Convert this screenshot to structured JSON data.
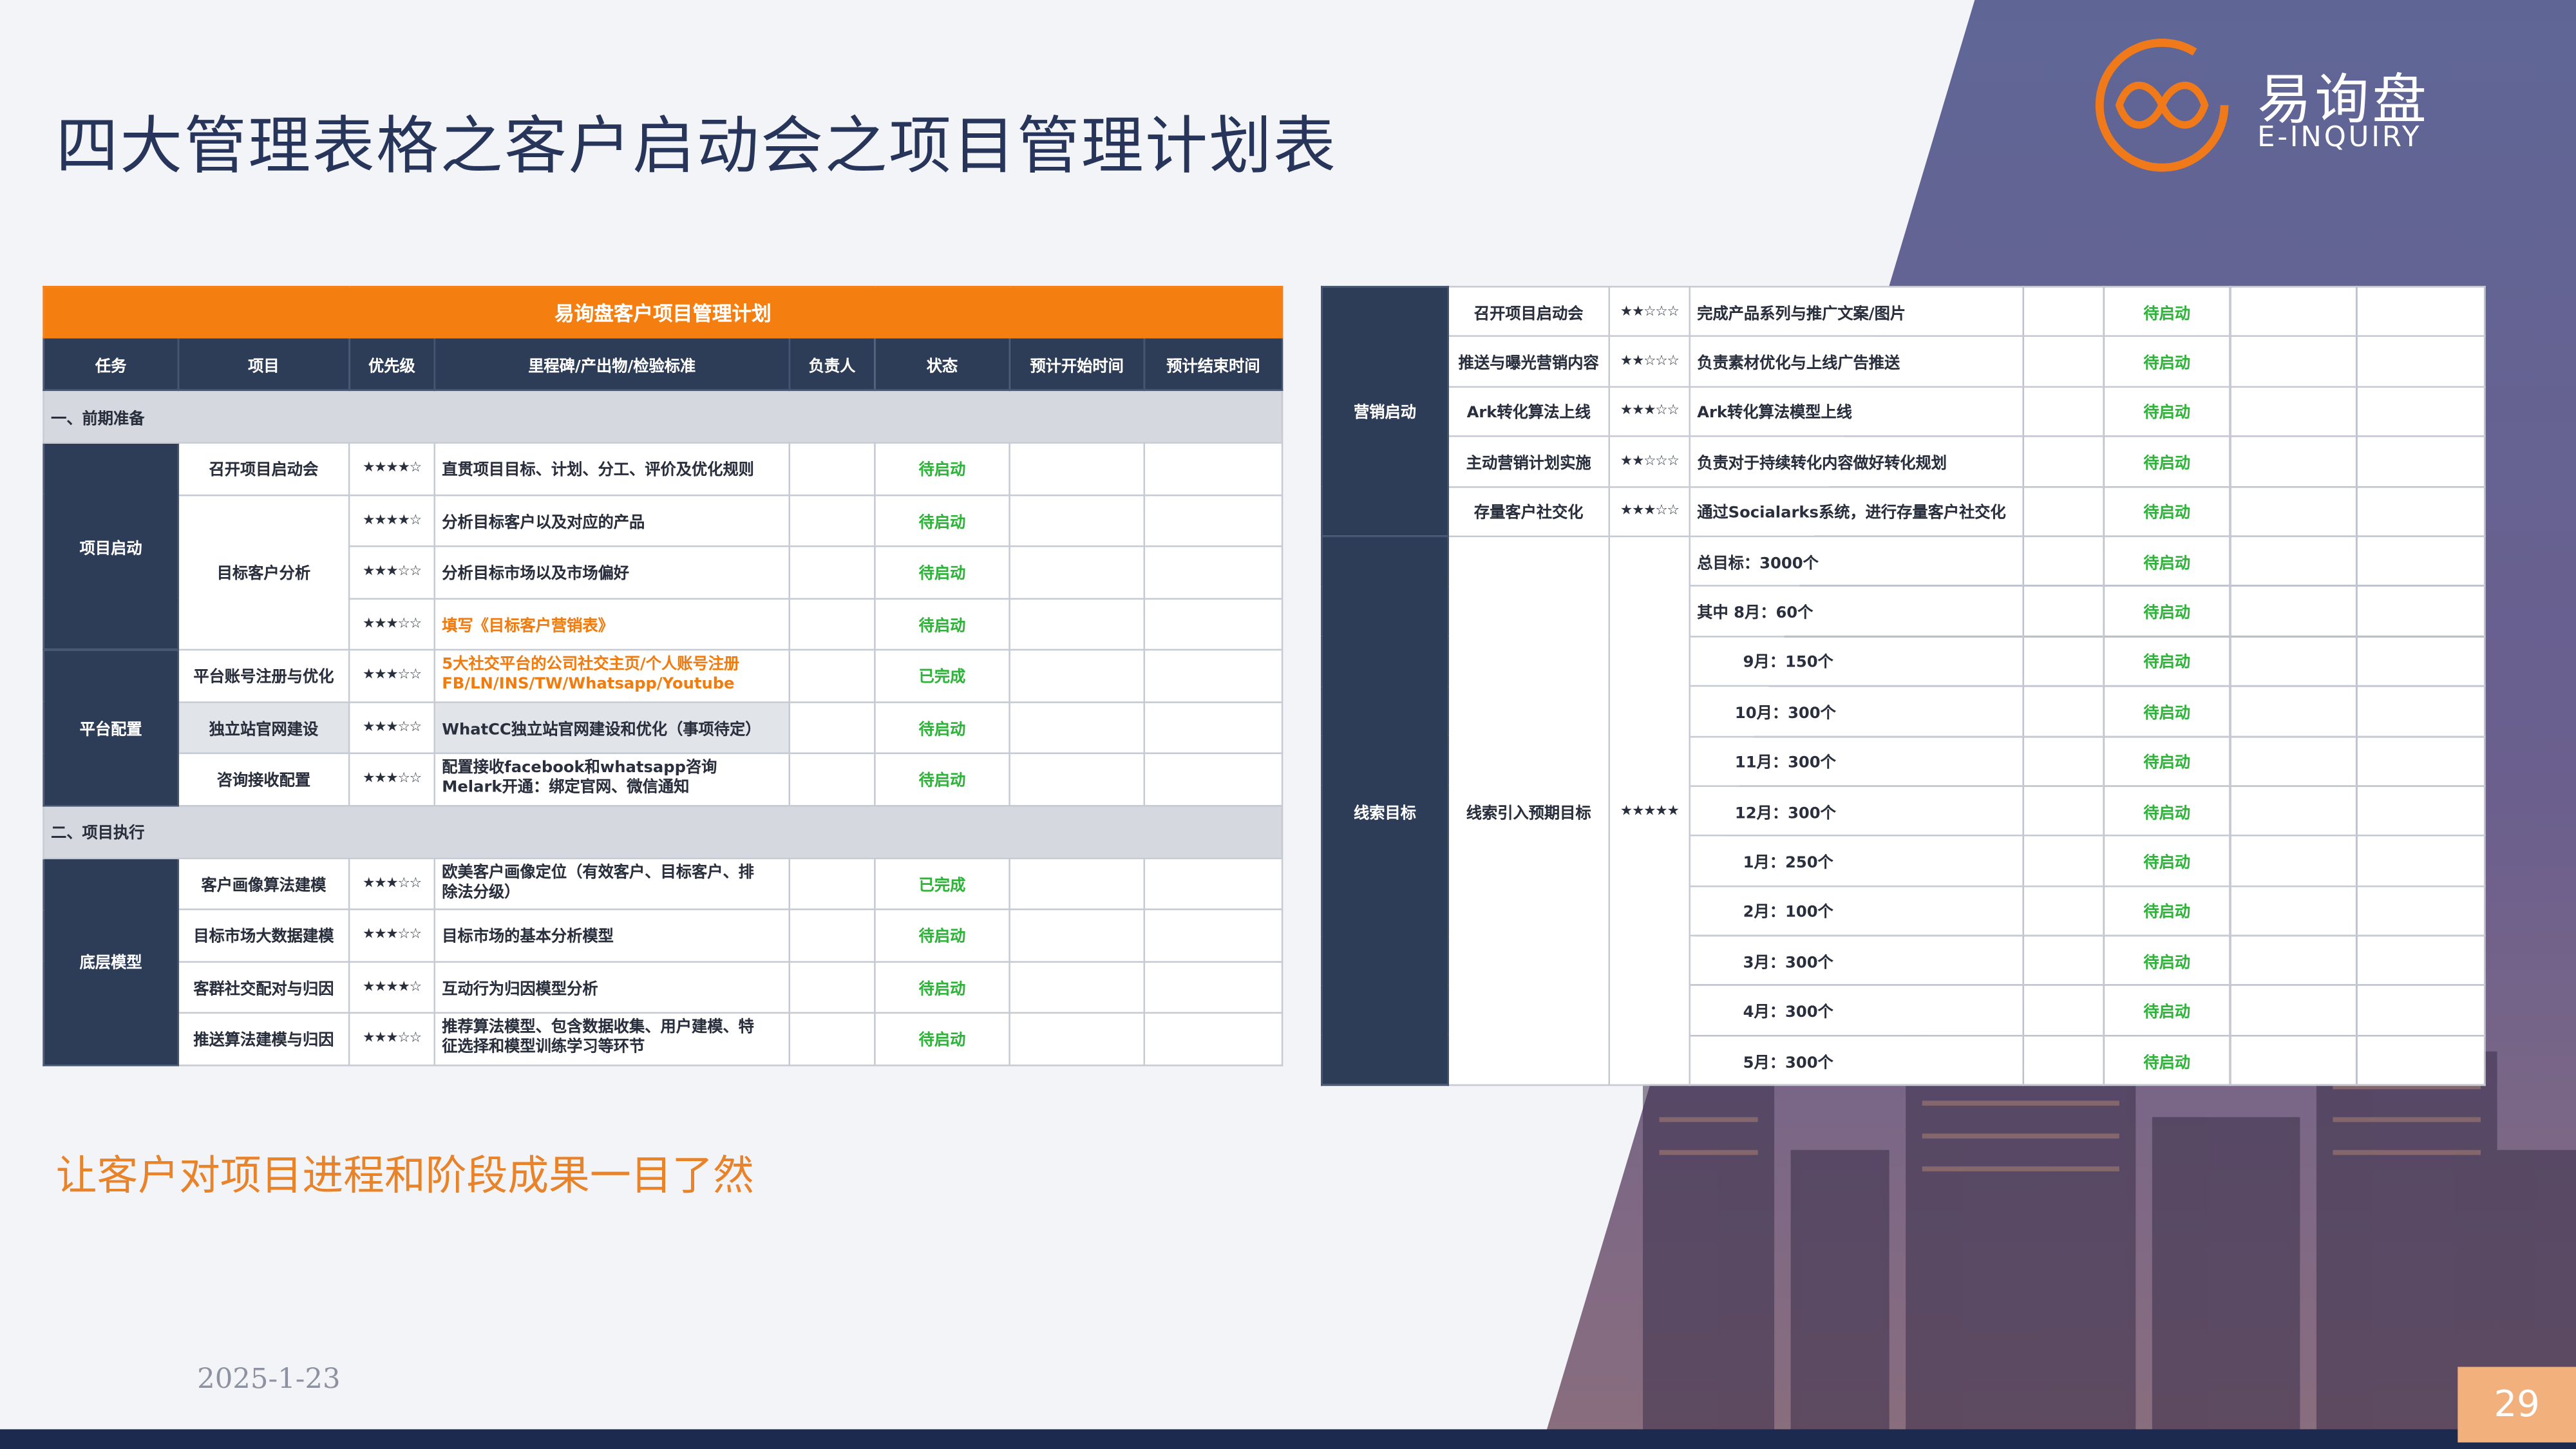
{
  "title": "四大管理表格之客户启动会之项目管理计划表",
  "subtitle": "让客户对项目进程和阶段成果一目了然",
  "date": "2025-1-23",
  "page_number": "29",
  "logo": {
    "zh": "易询盘",
    "en": "E-INQUIRY"
  },
  "colors": {
    "accent_orange": "#f57e10",
    "header_navy": "#2d3c57",
    "status_green": "#2fb33a",
    "title_navy": "#27355a"
  },
  "left_table": {
    "caption": "易询盘客户项目管理计划",
    "headers": [
      "任务",
      "项目",
      "优先级",
      "里程碑/产出物/检验标准",
      "负责人",
      "状态",
      "预计开始时间",
      "预计结束时间"
    ],
    "section1": "一、前期准备",
    "section2": "二、项目执行",
    "groups": [
      "项目启动",
      "平台配置",
      "底层模型"
    ],
    "rows": [
      {
        "item": "召开项目启动会",
        "priority": "★★★★☆",
        "milestone": "直贯项目目标、计划、分工、评价及优化规则",
        "status": "待启动"
      },
      {
        "item": "目标客户分析",
        "priority": "★★★★☆",
        "milestone": "分析目标客户以及对应的产品",
        "status": "待启动"
      },
      {
        "priority": "★★★☆☆",
        "milestone": "分析目标市场以及市场偏好",
        "status": "待启动"
      },
      {
        "priority": "★★★☆☆",
        "milestone": "填写《目标客户营销表》",
        "status": "待启动"
      },
      {
        "item": "平台账号注册与优化",
        "priority": "★★★☆☆",
        "milestone_l1": "5大社交平台的公司社交主页/个人账号注册",
        "milestone_l2": "FB/LN/INS/TW/Whatsapp/Youtube",
        "status": "已完成"
      },
      {
        "item": "独立站官网建设",
        "priority": "★★★☆☆",
        "milestone": "WhatCC独立站官网建设和优化（事项待定）",
        "status": "待启动"
      },
      {
        "item": "咨询接收配置",
        "priority": "★★★☆☆",
        "milestone_l1": "配置接收facebook和whatsapp咨询",
        "milestone_l2": "Melark开通：绑定官网、微信通知",
        "status": "待启动"
      },
      {
        "item": "客户画像算法建模",
        "priority": "★★★☆☆",
        "milestone_l1": "欧美客户画像定位（有效客户、目标客户、排",
        "milestone_l2": "除法分级）",
        "status": "已完成"
      },
      {
        "item": "目标市场大数据建模",
        "priority": "★★★☆☆",
        "milestone": "目标市场的基本分析模型",
        "status": "待启动"
      },
      {
        "item": "客群社交配对与归因",
        "priority": "★★★★☆",
        "milestone": "互动行为归因模型分析",
        "status": "待启动"
      },
      {
        "item": "推送算法建模与归因",
        "priority": "★★★☆☆",
        "milestone_l1": "推荐算法模型、包含数据收集、用户建模、特",
        "milestone_l2": "征选择和模型训练学习等环节",
        "status": "待启动"
      }
    ]
  },
  "right_table": {
    "groups": [
      "营销启动",
      "线索目标"
    ],
    "marketing_rows": [
      {
        "item": "召开项目启动会",
        "priority": "★★☆☆☆",
        "milestone": "完成产品系列与推广文案/图片",
        "status": "待启动"
      },
      {
        "item": "推送与曝光营销内容",
        "priority": "★★☆☆☆",
        "milestone": "负责素材优化与上线广告推送",
        "status": "待启动"
      },
      {
        "item": "Ark转化算法上线",
        "priority": "★★★☆☆",
        "milestone": "Ark转化算法模型上线",
        "status": "待启动"
      },
      {
        "item": "主动营销计划实施",
        "priority": "★★☆☆☆",
        "milestone": "负责对于持续转化内容做好转化规划",
        "status": "待启动"
      },
      {
        "item": "存量客户社交化",
        "priority": "★★★☆☆",
        "milestone": "通过Socialarks系统，进行存量客户社交化",
        "status": "待启动"
      }
    ],
    "leads_item": "线索引入预期目标",
    "leads_priority": "★★★★★",
    "leads_rows": [
      {
        "milestone": "总目标：3000个",
        "status": "待启动"
      },
      {
        "milestone": "其中  8月：60个",
        "status": "待启动"
      },
      {
        "milestone": "9月：150个",
        "status": "待启动"
      },
      {
        "milestone": "10月：300个",
        "status": "待启动"
      },
      {
        "milestone": "11月：300个",
        "status": "待启动"
      },
      {
        "milestone": "12月：300个",
        "status": "待启动"
      },
      {
        "milestone": "1月：250个",
        "status": "待启动"
      },
      {
        "milestone": "2月：100个",
        "status": "待启动"
      },
      {
        "milestone": "3月：300个",
        "status": "待启动"
      },
      {
        "milestone": "4月：300个",
        "status": "待启动"
      },
      {
        "milestone": "5月：300个",
        "status": "待启动"
      }
    ]
  }
}
